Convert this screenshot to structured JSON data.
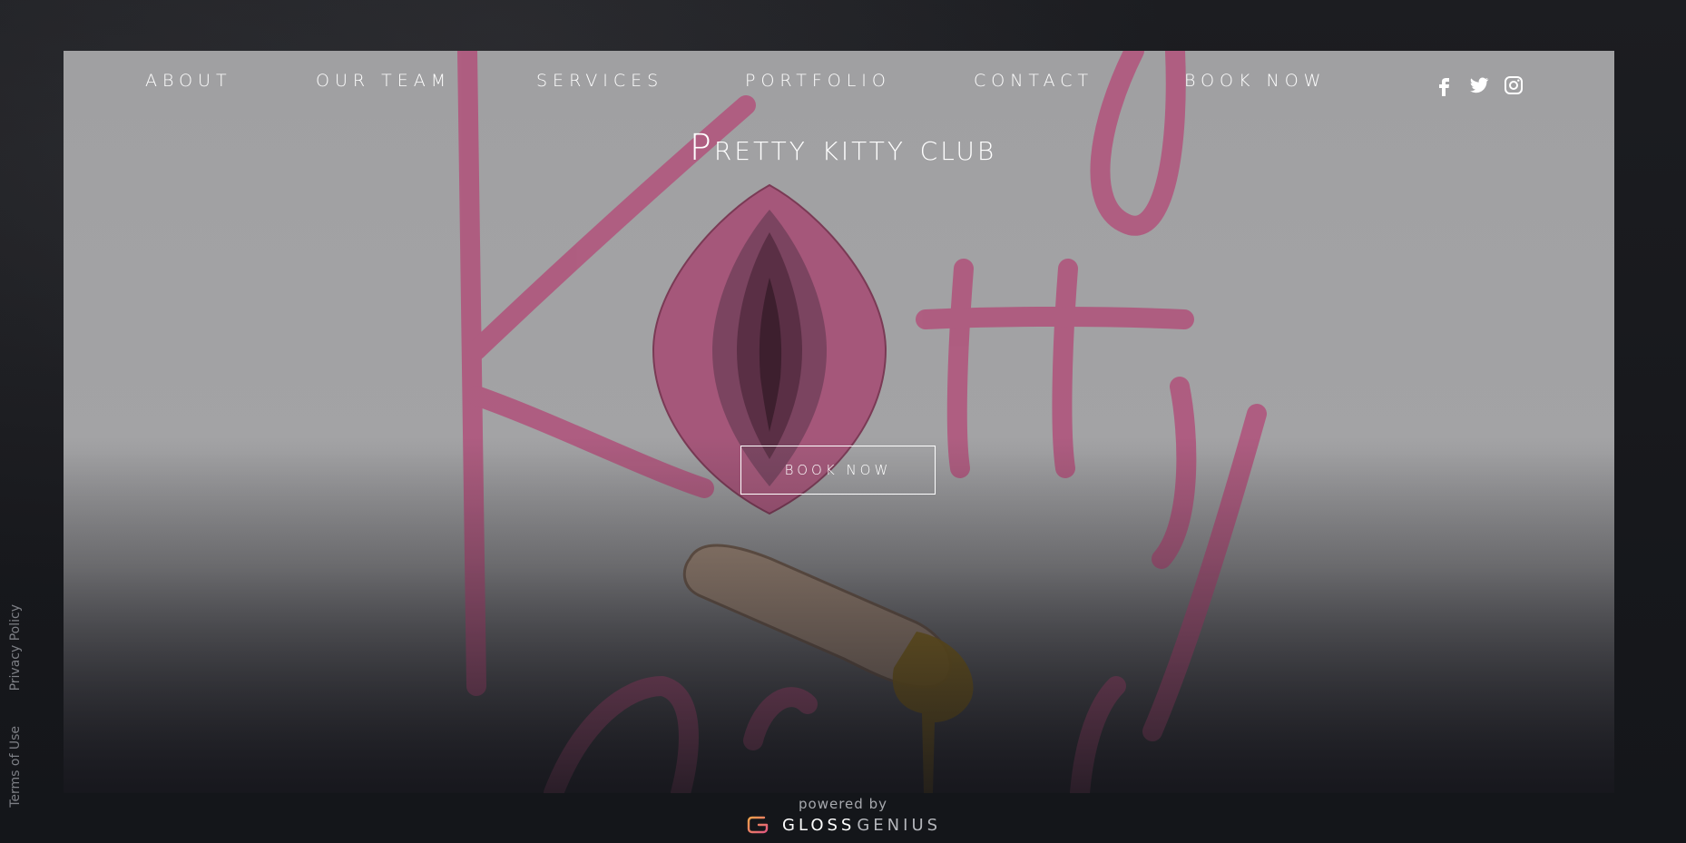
{
  "nav": {
    "items": [
      {
        "label": "ABOUT"
      },
      {
        "label": "OUR TEAM"
      },
      {
        "label": "SERVICES"
      },
      {
        "label": "PORTFOLIO"
      },
      {
        "label": "CONTACT"
      },
      {
        "label": "BOOK NOW"
      }
    ],
    "social": [
      "facebook-icon",
      "twitter-icon",
      "instagram-icon"
    ]
  },
  "hero": {
    "title": "Pretty kitty club",
    "cta_label": "BOOK NOW"
  },
  "side_links": {
    "privacy": "Privacy Policy",
    "terms": "Terms of Use"
  },
  "footer": {
    "powered_by": "powered by",
    "brand_primary": "GLOSS",
    "brand_secondary": "GENIUS"
  },
  "colors": {
    "background": "#15171c",
    "hero_gray": "#a0a0a2",
    "logo_pink": "#b0587e",
    "text_white": "#ffffff",
    "brand_gradient_start": "#f0a24a",
    "brand_gradient_end": "#e2587f"
  }
}
